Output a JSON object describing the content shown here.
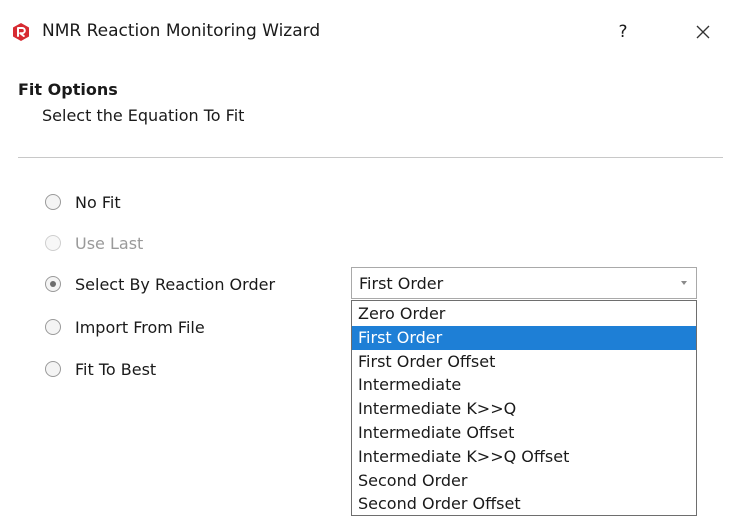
{
  "window": {
    "title": "NMR Reaction Monitoring Wizard",
    "help_label": "?",
    "icon": "app-logo-icon",
    "close_icon": "close-icon"
  },
  "section": {
    "heading": "Fit Options",
    "subheading": "Select the Equation To Fit"
  },
  "fit_options": {
    "options": [
      {
        "label": "No Fit",
        "checked": false,
        "enabled": true
      },
      {
        "label": "Use Last",
        "checked": false,
        "enabled": false
      },
      {
        "label": "Select By Reaction Order",
        "checked": true,
        "enabled": true
      },
      {
        "label": "Import From File",
        "checked": false,
        "enabled": true
      },
      {
        "label": "Fit To Best",
        "checked": false,
        "enabled": true
      }
    ]
  },
  "reaction_order": {
    "selected": "First Order",
    "options": [
      "Zero Order",
      "First Order",
      "First Order Offset",
      "Intermediate",
      "Intermediate K>>Q",
      "Intermediate Offset",
      "Intermediate K>>Q Offset",
      "Second Order",
      "Second Order Offset"
    ],
    "highlighted_index": 1
  },
  "colors": {
    "accent": "#1e7fd6",
    "app_icon": "#d72b32"
  }
}
